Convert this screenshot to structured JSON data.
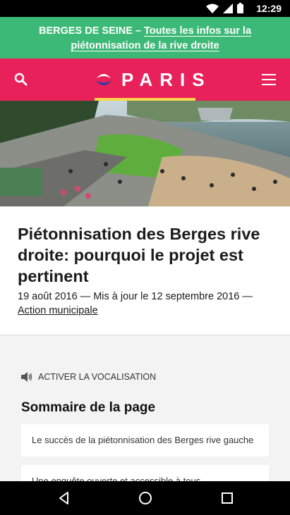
{
  "status": {
    "time": "12:29"
  },
  "banner": {
    "highlight": "BERGES DE SEINE",
    "separator": "–",
    "link": "Toutes les infos sur la piétonnisation de la rive droite"
  },
  "header": {
    "logo_text": "PARIS",
    "icons": {
      "search": "search-icon",
      "menu": "hamburger-menu-icon"
    },
    "colors": {
      "brand": "#e8215a",
      "accent": "#f7d64a",
      "banner": "#3db977"
    }
  },
  "article": {
    "title": "Piétonnisation des Berges rive droite: pourquoi le projet est pertinent",
    "date_line": "19 août 2016 — Mis à jour le 12 septembre 2016 —",
    "category": "Action municipale"
  },
  "vocalisation": {
    "label": "ACTIVER LA VOCALISATION",
    "icon": "speaker-icon"
  },
  "summary": {
    "title": "Sommaire de la page",
    "items": [
      {
        "label": "Le succès de la piétonnisation des Berges rive gauche"
      },
      {
        "label": "Une enquête ouverte et accessible à tous"
      }
    ]
  },
  "navbar": {
    "icons": [
      "back-icon",
      "home-icon",
      "recents-icon"
    ]
  }
}
